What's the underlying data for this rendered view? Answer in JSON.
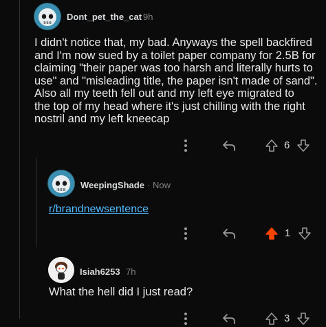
{
  "comments": [
    {
      "username": "Dont_pet_the_cat",
      "time": "9h",
      "body_lines": [
        "I didn't notice that, my bad. Anyways the spell backfired",
        "and I'm now sued by a toilet paper company for 2.5B for",
        "claiming \"their paper was too harsh and literally hurts to",
        "use\" and \"misleading title, the paper isn't made of sand\".",
        "Also all my teeth fell out and my left eye migrated to",
        "the top of my head where it's just chilling with the right",
        "nostril and my left kneecap"
      ],
      "votes": "6",
      "avatar_icon": "skull-astronaut-icon",
      "upvoted": false
    },
    {
      "username": "WeepingShade",
      "time": "Now",
      "link": "r/brandnewsentence",
      "votes": "1",
      "avatar_icon": "skull-astronaut-icon",
      "upvoted": true
    },
    {
      "username": "Isiah6253",
      "time": "7h",
      "body": "What the hell did I just read?",
      "votes": "3",
      "avatar_icon": "snoo-avatar-icon",
      "upvoted": false
    }
  ],
  "colors": {
    "background": "#0b0b0b",
    "upvote_active": "#ff4500",
    "link": "#4fbcff",
    "meta": "#818384"
  }
}
